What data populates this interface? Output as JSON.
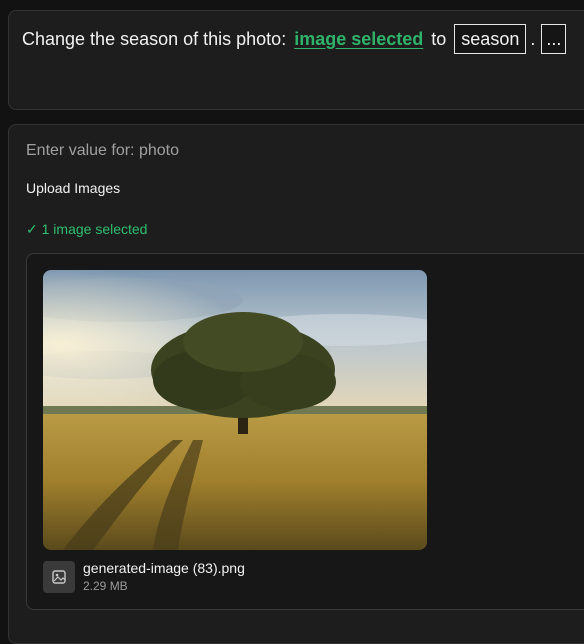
{
  "prompt": {
    "prefix": "Change the season of this photo:",
    "link": "image selected",
    "to_word": "to",
    "season_token": "season",
    "dot": ".",
    "more": "..."
  },
  "input": {
    "label": "Enter value for: photo",
    "upload_label": "Upload Images",
    "status": "✓ 1 image selected",
    "file": {
      "name": "generated-image (83).png",
      "size": "2.29 MB",
      "icon": "image-icon"
    }
  },
  "colors": {
    "background": "#121212",
    "card": "#1d1d1d",
    "accent_green": "#2fb36a"
  }
}
